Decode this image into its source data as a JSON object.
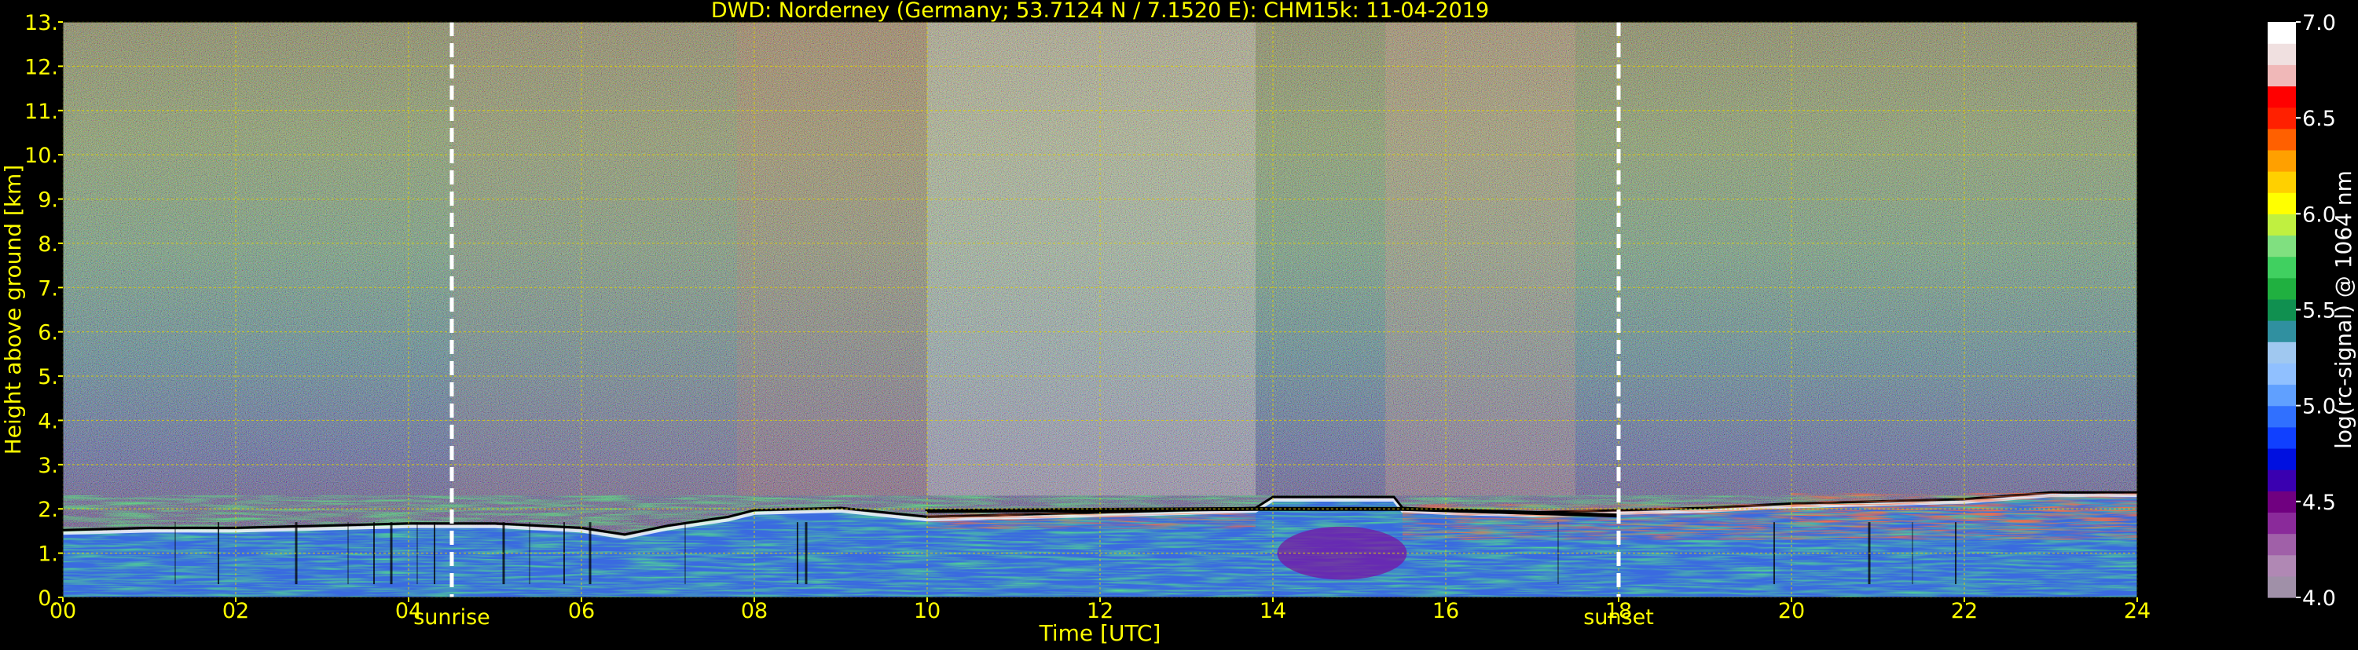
{
  "chart_data": {
    "type": "heatmap",
    "title": "DWD: Norderney (Germany; 53.7124 N / 7.1520 E):    CHM15k: 11-04-2019",
    "xlabel": "Time [UTC]",
    "ylabel": "Height above ground [km]",
    "xlim": [
      0,
      24
    ],
    "ylim": [
      0,
      13
    ],
    "x_ticks": [
      0,
      2,
      4,
      6,
      8,
      10,
      12,
      14,
      16,
      18,
      20,
      22,
      24
    ],
    "x_tick_labels": [
      "00",
      "02",
      "04",
      "06",
      "08",
      "10",
      "12",
      "14",
      "16",
      "18",
      "20",
      "22",
      "24"
    ],
    "y_ticks": [
      0,
      1,
      2,
      3,
      4,
      5,
      6,
      7,
      8,
      9,
      10,
      11,
      12,
      13
    ],
    "y_tick_labels": [
      "0.",
      "1.",
      "2.",
      "3.",
      "4.",
      "5.",
      "6.",
      "7.",
      "8.",
      "9.",
      "10.",
      "11.",
      "12.",
      "13."
    ],
    "grid": true,
    "markers": [
      {
        "label": "sunrise",
        "x": 4.5
      },
      {
        "label": "sunset",
        "x": 18.0
      }
    ],
    "colorbar": {
      "label": "log(rc-signal) @ 1064 nm",
      "range": [
        4.0,
        7.0
      ],
      "ticks": [
        4.0,
        4.5,
        5.0,
        5.5,
        6.0,
        6.5,
        7.0
      ],
      "tick_labels": [
        "4.0",
        "4.5",
        "5.0",
        "5.5",
        "6.0",
        "6.5",
        "7.0"
      ],
      "colors": [
        "#a090a8",
        "#b088b4",
        "#a060a8",
        "#8a2a9a",
        "#700080",
        "#3a00b0",
        "#0010e0",
        "#1040ff",
        "#3070ff",
        "#60a0ff",
        "#90c0ff",
        "#a0c8f0",
        "#3090a0",
        "#109050",
        "#20b040",
        "#40d060",
        "#80e080",
        "#c0f040",
        "#ffff00",
        "#ffd000",
        "#ffa000",
        "#ff6000",
        "#ff2000",
        "#ff0000",
        "#f0b8b8",
        "#f0e0e0",
        "#ffffff"
      ]
    },
    "layers": {
      "boundary_layer_top_km": [
        [
          0,
          1.45
        ],
        [
          1,
          1.5
        ],
        [
          2,
          1.5
        ],
        [
          3,
          1.55
        ],
        [
          4,
          1.6
        ],
        [
          5,
          1.6
        ],
        [
          6,
          1.5
        ],
        [
          6.5,
          1.35
        ],
        [
          7,
          1.55
        ],
        [
          7.7,
          1.75
        ],
        [
          8,
          1.9
        ],
        [
          9,
          1.95
        ],
        [
          10,
          1.75
        ],
        [
          11,
          1.8
        ],
        [
          12,
          1.85
        ],
        [
          13,
          1.9
        ],
        [
          13.8,
          1.95
        ],
        [
          14,
          2.2
        ],
        [
          15.4,
          2.2
        ],
        [
          15.5,
          1.95
        ],
        [
          16,
          1.9
        ],
        [
          17,
          1.85
        ],
        [
          18,
          1.9
        ],
        [
          19,
          1.95
        ],
        [
          20,
          2.05
        ],
        [
          21,
          2.1
        ],
        [
          22,
          2.15
        ],
        [
          23,
          2.3
        ],
        [
          24,
          2.3
        ]
      ],
      "ceiling_line_km": [
        [
          10,
          1.95
        ],
        [
          13.8,
          2.0
        ],
        [
          15.5,
          2.0
        ],
        [
          18,
          1.85
        ]
      ]
    }
  }
}
